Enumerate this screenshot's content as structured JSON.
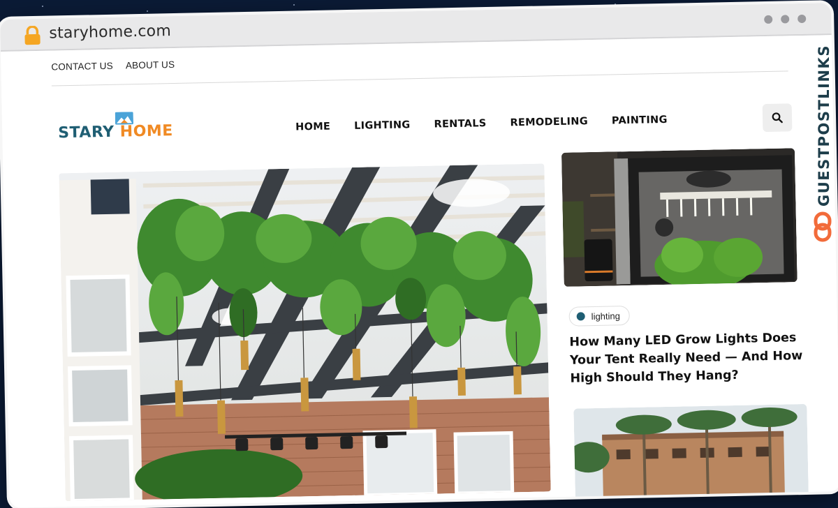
{
  "browser": {
    "url": "staryhome.com",
    "lock_icon": "lock-icon"
  },
  "topnav": {
    "contact": "CONTACT US",
    "about": "ABOUT US"
  },
  "logo": {
    "part1": "STARY",
    "part2": "HOME"
  },
  "mainnav": {
    "items": [
      "HOME",
      "LIGHTING",
      "RENTALS",
      "REMODELING",
      "PAINTING"
    ]
  },
  "search": {
    "icon": "search-icon"
  },
  "featured": {
    "image": "hanging-plants-ceiling-photo"
  },
  "sidebar_post": {
    "image": "grow-tent-photo",
    "tag": "lighting",
    "title": "How Many LED Grow Lights Does Your Tent Really Need — And How High Should They Hang?"
  },
  "sidebar_post_2": {
    "image": "palm-trees-building-photo"
  },
  "brand_watermark": "GUESTPOSTLINKS",
  "colors": {
    "background": "#0b1b36",
    "logo_primary": "#1f5e73",
    "logo_accent": "#f08a24",
    "watermark": "#1d3d4a",
    "watermark_icon": "#f26b3a"
  }
}
